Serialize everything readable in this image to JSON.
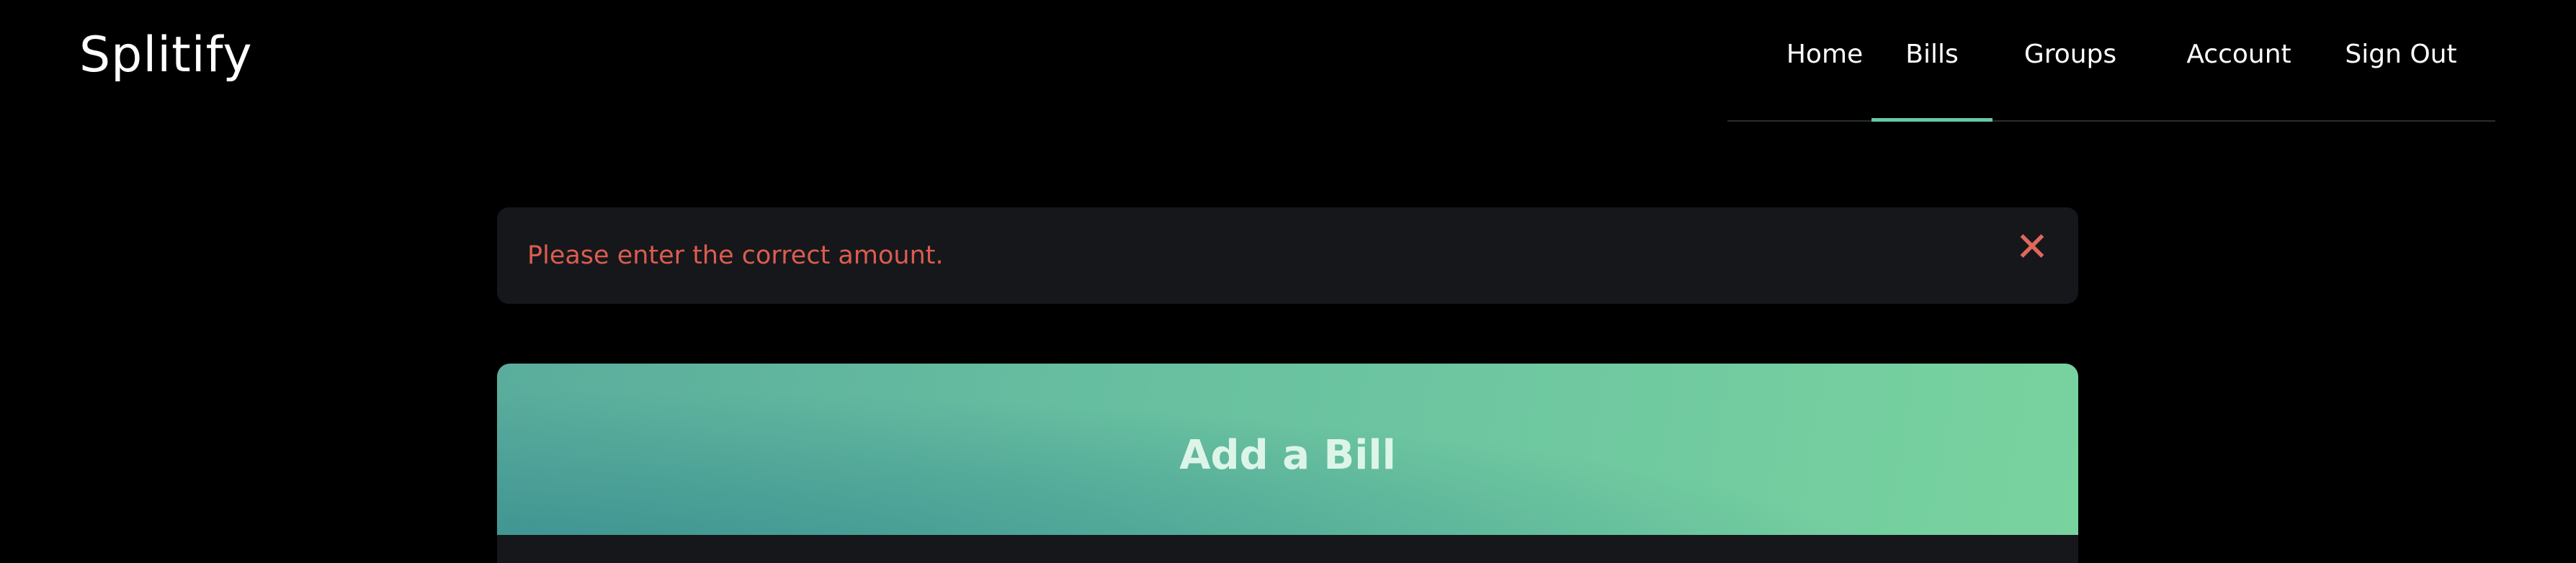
{
  "app": {
    "brand": "Splitify"
  },
  "navigation": {
    "items": [
      {
        "label": "Home",
        "active": false
      },
      {
        "label": "Bills",
        "active": true
      },
      {
        "label": "Groups",
        "active": false
      },
      {
        "label": "Account",
        "active": false
      },
      {
        "label": "Sign Out",
        "active": false
      }
    ]
  },
  "alert": {
    "message": "Please enter the correct amount.",
    "close_icon": "close-icon",
    "close_glyph": "✕",
    "color": "#dc5c4f"
  },
  "bill_card": {
    "title": "Add a Bill"
  },
  "colors": {
    "background": "#000000",
    "surface": "#15171b",
    "accent": "#68c6a3",
    "error": "#dc5c4f",
    "card_header_start": "#368b8f",
    "card_header_end": "#78d39f"
  }
}
